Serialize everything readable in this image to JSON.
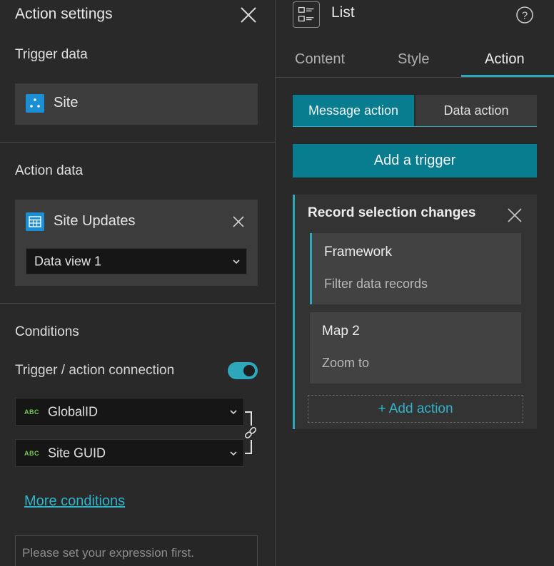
{
  "left_panel": {
    "title": "Action settings",
    "trigger_section": {
      "label": "Trigger data",
      "source_name": "Site"
    },
    "action_section": {
      "label": "Action data",
      "source_name": "Site Updates",
      "data_view": "Data view 1"
    },
    "conditions": {
      "label": "Conditions",
      "connection_label": "Trigger / action connection",
      "connection_enabled": true,
      "trigger_field": {
        "type_badge": "ABC",
        "value": "GlobalID"
      },
      "action_field": {
        "type_badge": "ABC",
        "value": "Site GUID"
      },
      "more_link": "More conditions",
      "expression_placeholder": "Please set your expression first."
    }
  },
  "right_panel": {
    "widget_title": "List",
    "tabs": [
      {
        "label": "Content",
        "active": false
      },
      {
        "label": "Style",
        "active": false
      },
      {
        "label": "Action",
        "active": true
      }
    ],
    "segmented": {
      "message_action": "Message action",
      "data_action": "Data action",
      "active": "message_action"
    },
    "add_trigger_label": "Add a trigger",
    "trigger": {
      "title": "Record selection changes",
      "actions": [
        {
          "name": "Framework",
          "description": "Filter data records",
          "selected": true
        },
        {
          "name": "Map 2",
          "description": "Zoom to",
          "selected": false
        }
      ],
      "add_action_label": "+ Add action"
    }
  },
  "colors": {
    "accent": "#2ea7bd",
    "button_teal": "#087d8f",
    "datasource_blue": "#1a8fd6",
    "field_type_green": "#74c94a"
  }
}
